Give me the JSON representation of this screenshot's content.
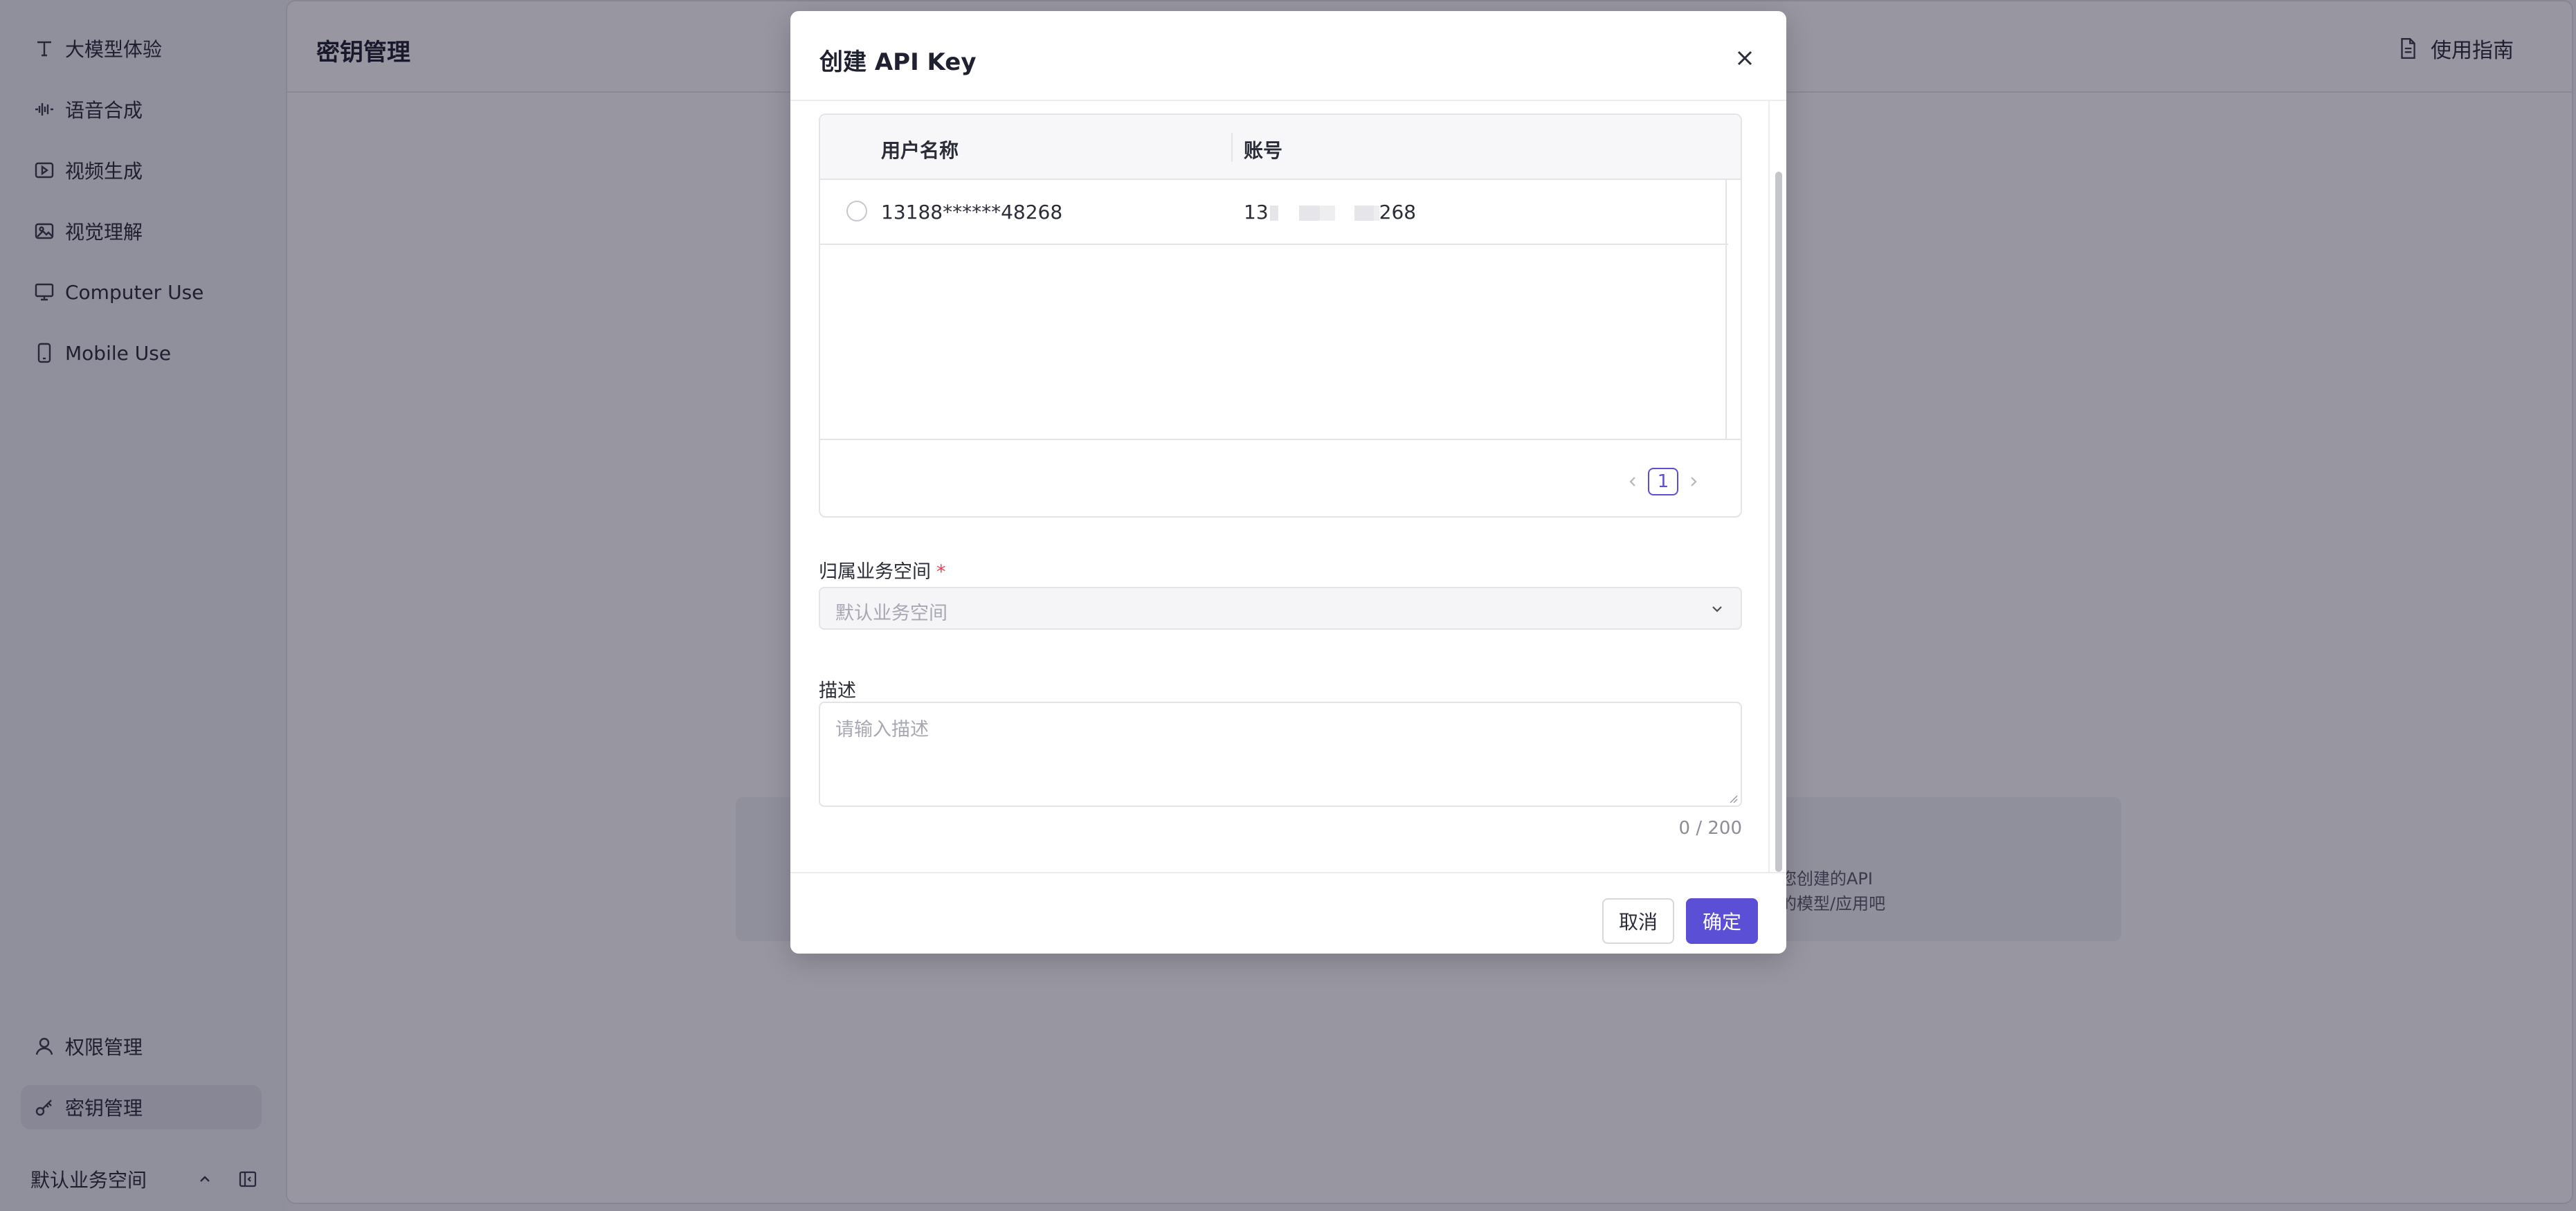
{
  "sidebar": {
    "items": [
      {
        "label": "大模型体验",
        "icon": "text-icon"
      },
      {
        "label": "语音合成",
        "icon": "waveform-icon"
      },
      {
        "label": "视频生成",
        "icon": "video-icon"
      },
      {
        "label": "视觉理解",
        "icon": "image-icon"
      },
      {
        "label": "Computer Use",
        "icon": "monitor-icon"
      },
      {
        "label": "Mobile Use",
        "icon": "mobile-icon"
      }
    ],
    "bottom_items": [
      {
        "label": "权限管理",
        "icon": "user-icon"
      },
      {
        "label": "密钥管理",
        "icon": "key-icon",
        "active": true
      }
    ],
    "workspace": "默认业务空间"
  },
  "main": {
    "title": "密钥管理",
    "guide_link": "使用指南",
    "empty_line1": "您创建的API",
    "empty_line2": "的模型/应用吧"
  },
  "modal": {
    "title": "创建 API Key",
    "table": {
      "columns": [
        "用户名称",
        "账号"
      ],
      "rows": [
        {
          "username": "13188******48268",
          "account_prefix": "13",
          "account_suffix": "268"
        }
      ]
    },
    "pagination": {
      "current_page": "1"
    },
    "workspace_field": {
      "label": "归属业务空间",
      "required_mark": "*",
      "value": "默认业务空间"
    },
    "description_field": {
      "label": "描述",
      "placeholder": "请输入描述",
      "char_count": "0 / 200"
    },
    "buttons": {
      "cancel": "取消",
      "confirm": "确定"
    }
  },
  "colors": {
    "accent": "#5b4fd6",
    "required": "#e0475a",
    "overlay": "rgba(18,16,42,0.44)"
  }
}
